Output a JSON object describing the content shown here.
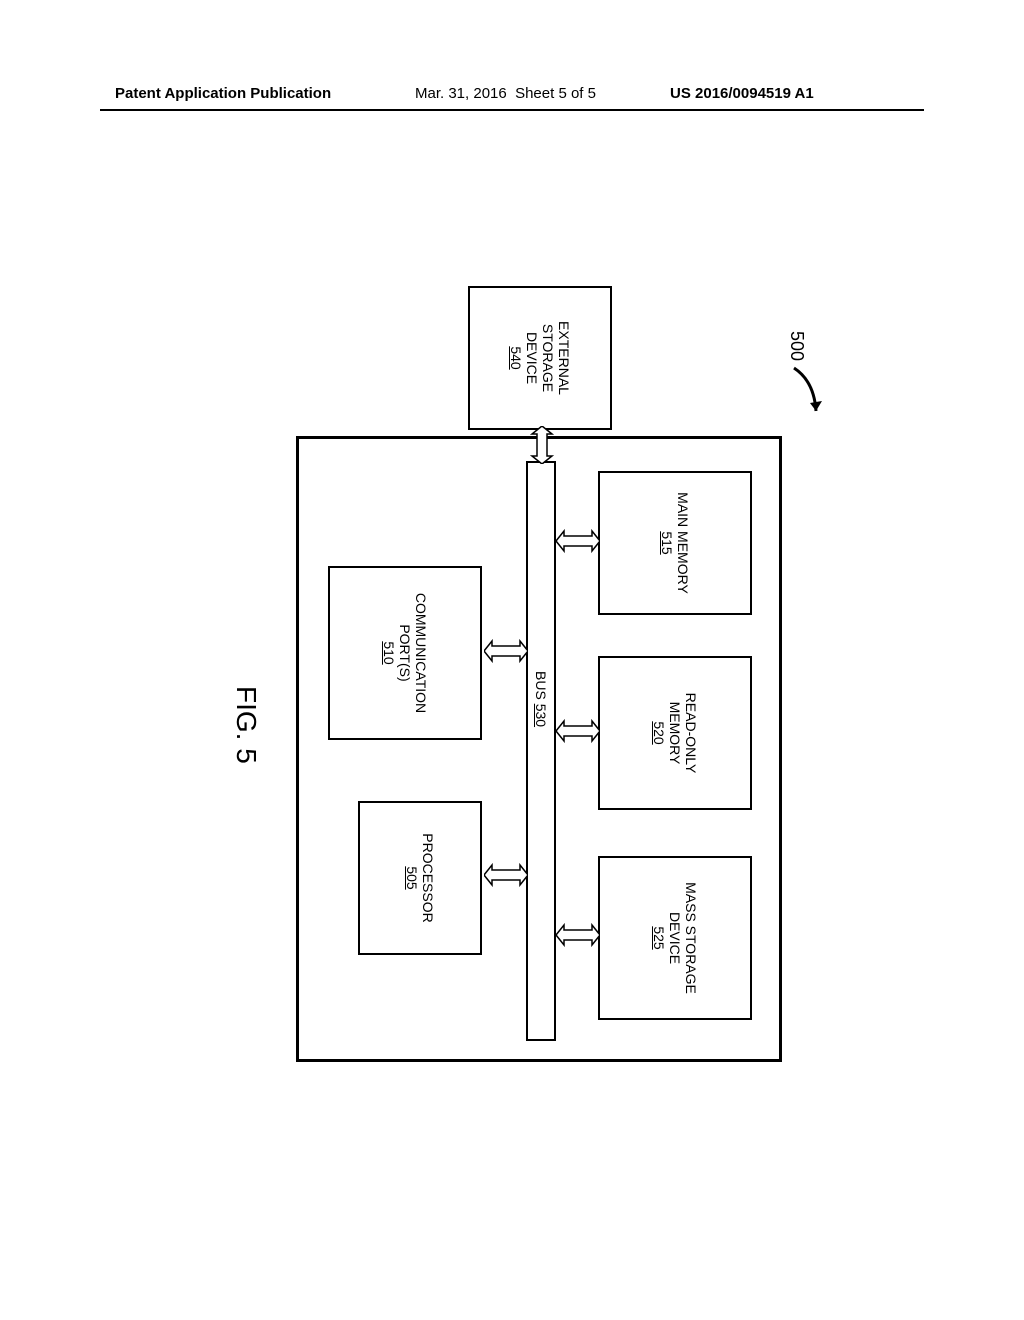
{
  "header": {
    "left": "Patent Application Publication",
    "date": "Mar. 31, 2016",
    "sheet": "Sheet 5 of 5",
    "pub": "US 2016/0094519 A1"
  },
  "figure_label": "FIG. 5",
  "reference": "500",
  "blocks": {
    "main_memory": {
      "name": "MAIN MEMORY",
      "num": "515"
    },
    "rom": {
      "name": "READ-ONLY\nMEMORY",
      "num": "520"
    },
    "mass_storage": {
      "name": "MASS STORAGE\nDEVICE",
      "num": "525"
    },
    "bus": {
      "name": "BUS",
      "num": "530"
    },
    "comm": {
      "name": "COMMUNICATION\nPORT(S)",
      "num": "510"
    },
    "processor": {
      "name": "PROCESSOR",
      "num": "505"
    },
    "external": {
      "name": "EXTERNAL STORAGE\nDEVICE",
      "num": "540"
    }
  }
}
